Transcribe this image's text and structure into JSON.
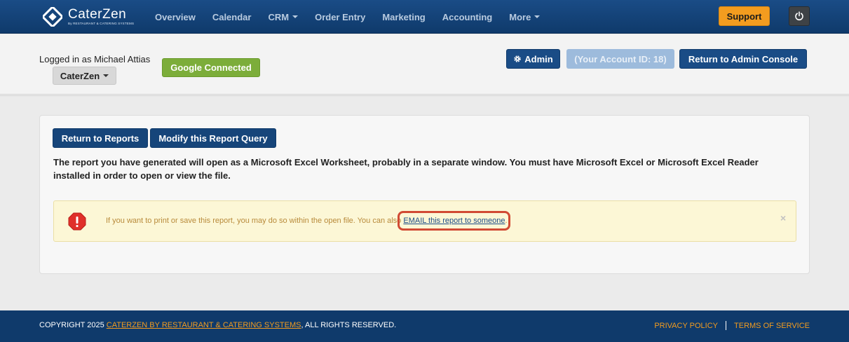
{
  "brand": {
    "name": "CaterZen",
    "tagline": "By RESTAURANT & CATERING SYSTEMS"
  },
  "nav": {
    "items": [
      {
        "label": "Overview",
        "dropdown": false
      },
      {
        "label": "Calendar",
        "dropdown": false
      },
      {
        "label": "CRM",
        "dropdown": true
      },
      {
        "label": "Order Entry",
        "dropdown": false
      },
      {
        "label": "Marketing",
        "dropdown": false
      },
      {
        "label": "Accounting",
        "dropdown": false
      },
      {
        "label": "More",
        "dropdown": true
      }
    ],
    "support_label": "Support",
    "power_icon": "power-icon"
  },
  "subheader": {
    "logged_in_text": "Logged in as Michael Attias",
    "account_dropdown": "CaterZen",
    "google_label": "Google Connected",
    "admin_label": "Admin",
    "account_id_label": "(Your Account ID: 18)",
    "return_admin_label": "Return to Admin Console"
  },
  "panel": {
    "return_reports_label": "Return to Reports",
    "modify_query_label": "Modify this Report Query",
    "report_message": "The report you have generated will open as a Microsoft Excel Worksheet, probably in a separate window. You must have Microsoft Excel or Microsoft Excel Reader installed in order to open or view the file.",
    "alert": {
      "text": "If you want to print or save this report, you may do so within the open file. You can also",
      "link": "EMAIL this report to someone",
      "trailing": ".",
      "close": "×"
    }
  },
  "footer": {
    "copyright_prefix": "COPYRIGHT 2025 ",
    "copyright_link": "CATERZEN BY RESTAURANT & CATERING SYSTEMS",
    "copyright_suffix": ", ALL RIGHTS RESERVED.",
    "privacy": "PRIVACY POLICY",
    "terms": "TERMS OF SERVICE"
  },
  "colors": {
    "navbar": "#1a4c86",
    "support": "#f39c1f",
    "google": "#7cad3a",
    "alert_bg": "#fcf7d6",
    "highlight": "#d14a33"
  }
}
